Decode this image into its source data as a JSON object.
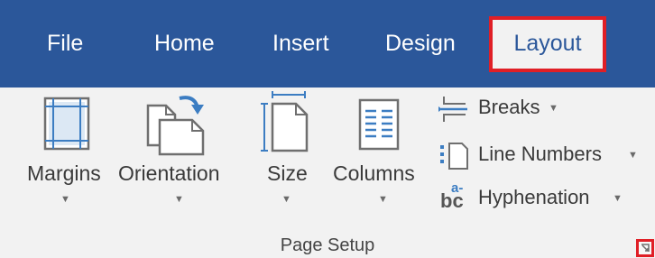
{
  "tabs": {
    "file": "File",
    "home": "Home",
    "insert": "Insert",
    "design": "Design",
    "layout": "Layout"
  },
  "ribbon": {
    "margins": "Margins",
    "orientation": "Orientation",
    "size": "Size",
    "columns": "Columns",
    "breaks": "Breaks",
    "line_numbers": "Line Numbers",
    "hyphenation": "Hyphenation",
    "hyphenation_icon_text": "bc",
    "hyphenation_icon_sup": "a-",
    "dropdown_arrow": "▼",
    "group_label": "Page Setup"
  },
  "colors": {
    "tab_bar": "#2b579a",
    "ribbon_bg": "#f2f2f2",
    "highlight": "#e01f26"
  },
  "icons": [
    "margins-icon",
    "orientation-icon",
    "size-icon",
    "columns-icon",
    "breaks-icon",
    "line-numbers-icon",
    "hyphenation-icon",
    "dialog-launcher-icon"
  ]
}
